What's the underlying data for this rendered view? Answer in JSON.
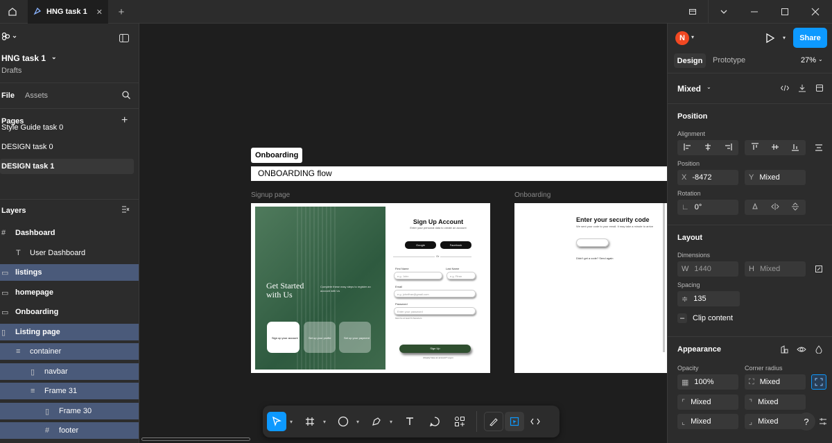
{
  "topbar": {
    "tab_title": "HNG task 1",
    "tab_close": "✕",
    "new_tab": "+"
  },
  "left": {
    "file_name": "HNG task 1",
    "file_sub": "Drafts",
    "tab_file": "File",
    "tab_assets": "Assets",
    "pages_label": "Pages",
    "pages": [
      "Style Guide task 0",
      "DESIGN task 0",
      "DESIGN task 1"
    ],
    "layers_label": "Layers",
    "layers": [
      {
        "label": "Dashboard",
        "icon": "#",
        "indent": 0,
        "bold": true,
        "sel": false
      },
      {
        "label": "User Dashboard",
        "icon": "T",
        "indent": 1,
        "bold": false,
        "sel": false
      },
      {
        "label": "listings",
        "icon": "▭",
        "indent": 0,
        "bold": true,
        "sel": true
      },
      {
        "label": "homepage",
        "icon": "▭",
        "indent": 0,
        "bold": true,
        "sel": false
      },
      {
        "label": "Onboarding",
        "icon": "▭",
        "indent": 0,
        "bold": true,
        "sel": false
      },
      {
        "label": "Listing page",
        "icon": "▯",
        "indent": 0,
        "bold": true,
        "sel": true
      },
      {
        "label": "container",
        "icon": "≡",
        "indent": 1,
        "bold": false,
        "sel": true
      },
      {
        "label": "navbar",
        "icon": "▯",
        "indent": 2,
        "bold": false,
        "sel": true
      },
      {
        "label": "Frame 31",
        "icon": "≡",
        "indent": 2,
        "bold": false,
        "sel": true
      },
      {
        "label": "Frame 30",
        "icon": "▯",
        "indent": 3,
        "bold": false,
        "sel": true
      },
      {
        "label": "footer",
        "icon": "#",
        "indent": 3,
        "bold": false,
        "sel": true
      }
    ]
  },
  "canvas": {
    "section_tag": "Onboarding",
    "section_title": "ONBOARDING flow",
    "frame1_label": "Signup page",
    "frame2_label": "Onboarding",
    "signup": {
      "hero_title": "Get Started with Us",
      "hero_text": "Complete these easy steps to register an account with Us",
      "steps": [
        "Sign up your account",
        "Set up your profile",
        "Set up your payment"
      ],
      "form_title": "Sign Up Account",
      "form_sub": "Enter your personal data to create an account",
      "google": "Google",
      "facebook": "Facebook",
      "or": "Or",
      "first_name_label": "First Name",
      "first_name_ph": "e.g. John",
      "last_name_label": "Last Name",
      "last_name_ph": "e.g. Ffran",
      "email_label": "Email",
      "email_ph": "e.g. johnffran@gmail.com",
      "password_label": "Password",
      "password_ph": "Enter your password",
      "password_hint": "Must be at least 8 characters",
      "signup_btn": "Sign Up",
      "login_text": "Already have an account? Log in"
    },
    "security": {
      "title": "Enter your security code",
      "text": "We sent your code to your email. It may take a minute to arrive",
      "resend": "Didn't get a code? Send again"
    }
  },
  "right": {
    "avatar_initial": "N",
    "share_label": "Share",
    "tab_design": "Design",
    "tab_prototype": "Prototype",
    "zoom": "27%",
    "selection": "Mixed",
    "position_label": "Position",
    "alignment_label": "Alignment",
    "position_sub": "Position",
    "x_key": "X",
    "x_val": "-8472",
    "y_key": "Y",
    "y_val": "Mixed",
    "rotation_label": "Rotation",
    "rotation_val": "0°",
    "layout_label": "Layout",
    "dimensions_label": "Dimensions",
    "w_key": "W",
    "w_val": "1440",
    "h_key": "H",
    "h_val": "Mixed",
    "spacing_label": "Spacing",
    "spacing_val": "135",
    "clip_label": "Clip content",
    "appearance_label": "Appearance",
    "opacity_label": "Opacity",
    "opacity_val": "100%",
    "corner_label": "Corner radius",
    "corner_val": "Mixed",
    "mixed1": "Mixed",
    "mixed2": "Mixed",
    "mixed3": "Mixed",
    "mixed4": "Mixed",
    "help": "?"
  },
  "colors": {
    "accent": "#0d99ff",
    "selection": "#4a5a7a",
    "avatar": "#f24822",
    "hero_green": "#3d6b4f",
    "button_green": "#2f4f2f"
  }
}
